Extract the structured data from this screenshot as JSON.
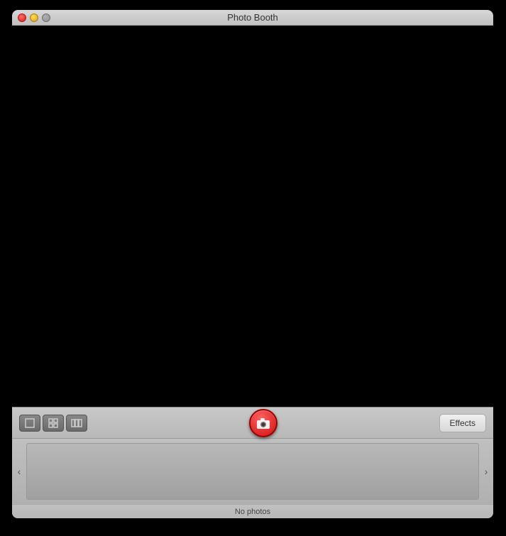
{
  "window": {
    "title": "Photo Booth"
  },
  "traffic_lights": {
    "close_label": "close",
    "minimize_label": "minimize",
    "zoom_label": "zoom"
  },
  "toolbar": {
    "view_single_label": "single view",
    "view_grid_label": "grid view",
    "view_strip_label": "strip view",
    "capture_label": "Take Photo",
    "effects_label": "Effects"
  },
  "scroll": {
    "left_label": "‹",
    "right_label": "›"
  },
  "status": {
    "no_photos_label": "No photos"
  }
}
